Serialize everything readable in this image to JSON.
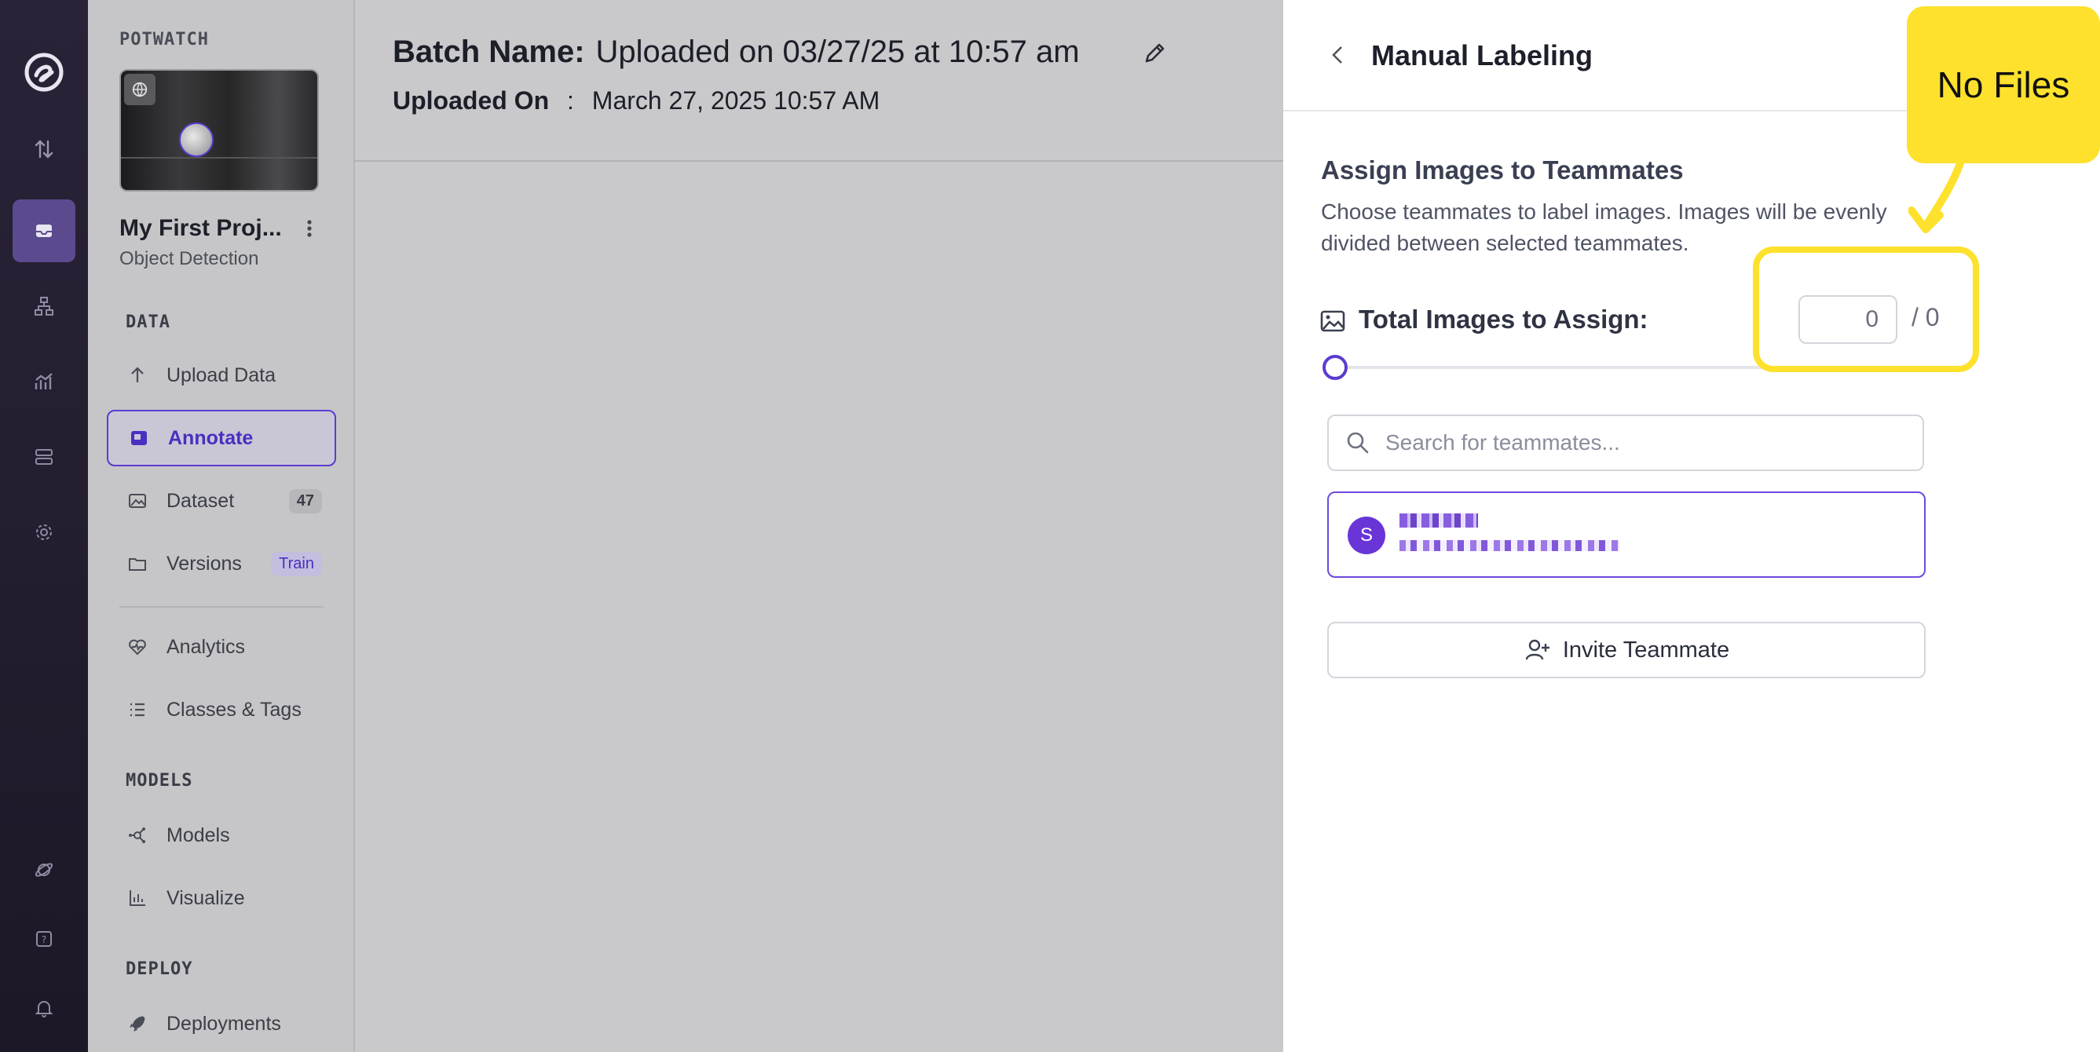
{
  "project": {
    "org_label": "POTWATCH",
    "name": "My First Proj...",
    "type": "Object Detection"
  },
  "sidebar": {
    "sections": {
      "data": "DATA",
      "models": "MODELS",
      "deploy": "DEPLOY"
    },
    "items": [
      {
        "label": "Upload Data"
      },
      {
        "label": "Annotate"
      },
      {
        "label": "Dataset",
        "badge": "47"
      },
      {
        "label": "Versions",
        "badge": "Train"
      },
      {
        "label": "Analytics"
      },
      {
        "label": "Classes & Tags"
      },
      {
        "label": "Models"
      },
      {
        "label": "Visualize"
      },
      {
        "label": "Deployments"
      }
    ]
  },
  "main": {
    "batch_label": "Batch Name:",
    "batch_value": "Uploaded on 03/27/25 at 10:57 am",
    "uploaded_label": "Uploaded On",
    "uploaded_sep": ":",
    "uploaded_value": "March 27, 2025 10:57 AM"
  },
  "panel": {
    "title": "Manual Labeling",
    "assign_title": "Assign Images to Teammates",
    "assign_desc": "Choose teammates to label images. Images will be evenly divided between selected teammates.",
    "total_label": "Total Images to Assign:",
    "total_value": "0",
    "of_total": "/ 0",
    "search_placeholder": "Search for teammates...",
    "teammate_initial": "S",
    "invite_label": "Invite Teammate"
  },
  "annotation": {
    "callout_text": "No Files",
    "color": "#fde12d"
  },
  "colors": {
    "accent": "#5b3bd0",
    "rail": "#2a2338"
  }
}
